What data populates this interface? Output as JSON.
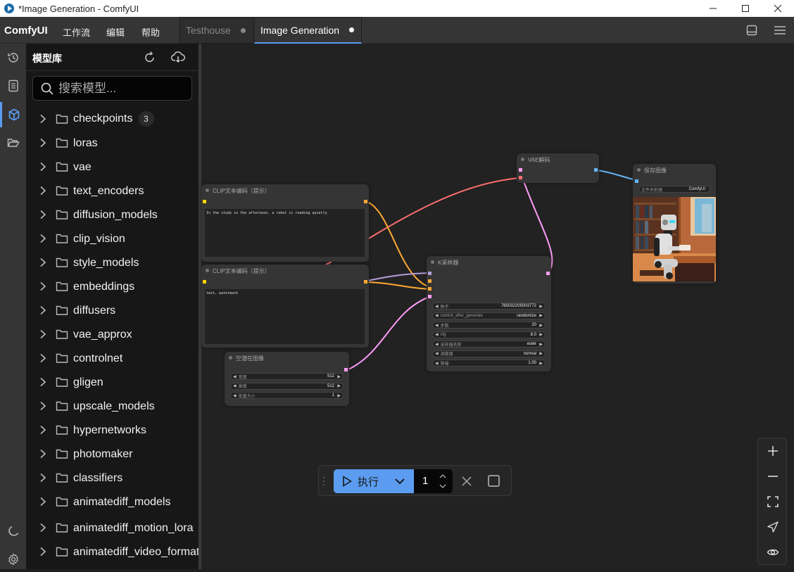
{
  "window": {
    "title": "*Image Generation - ComfyUI",
    "controls": [
      "minimize-icon",
      "maximize-icon",
      "close-icon"
    ]
  },
  "menubar": {
    "brand": "ComfyUI",
    "menus": [
      "工作流",
      "编辑",
      "帮助"
    ],
    "tabs": [
      {
        "label": "Testhouse",
        "active": false,
        "unsaved": true
      },
      {
        "label": "Image Generation",
        "active": true,
        "unsaved": true
      }
    ],
    "right_icons": [
      "bottom-panel-icon",
      "hamburger-menu-icon"
    ]
  },
  "iconbar": {
    "items": [
      {
        "name": "history-icon",
        "active": false
      },
      {
        "name": "queue-icon",
        "active": false
      },
      {
        "name": "model-library-icon",
        "active": true
      },
      {
        "name": "workflows-icon",
        "active": false
      }
    ],
    "bottom": [
      "theme-toggle-icon",
      "settings-icon"
    ]
  },
  "sidebar": {
    "title": "模型库",
    "refresh_icon": "refresh-icon",
    "download_icon": "cloud-download-icon",
    "search_placeholder": "搜索模型...",
    "folders": [
      {
        "label": "checkpoints",
        "count": "3"
      },
      {
        "label": "loras"
      },
      {
        "label": "vae"
      },
      {
        "label": "text_encoders"
      },
      {
        "label": "diffusion_models"
      },
      {
        "label": "clip_vision"
      },
      {
        "label": "style_models"
      },
      {
        "label": "embeddings"
      },
      {
        "label": "diffusers"
      },
      {
        "label": "vae_approx"
      },
      {
        "label": "controlnet"
      },
      {
        "label": "gligen"
      },
      {
        "label": "upscale_models"
      },
      {
        "label": "hypernetworks"
      },
      {
        "label": "photomaker"
      },
      {
        "label": "classifiers"
      },
      {
        "label": "animatediff_models"
      },
      {
        "label": "animatediff_motion_lora"
      },
      {
        "label": "animatediff_video_formats"
      }
    ]
  },
  "nodes": {
    "clip_positive": {
      "title": "CLIP文本编码（提示）",
      "text": "In the study in the afternoon, a robot is reading quietly"
    },
    "clip_negative": {
      "title": "CLIP文本编码（提示）",
      "text": "text, watermark"
    },
    "empty_latent": {
      "title": "空潜在图像",
      "widgets": [
        {
          "label": "宽度",
          "value": "512"
        },
        {
          "label": "高度",
          "value": "512"
        },
        {
          "label": "批量大小",
          "value": "1"
        }
      ]
    },
    "ksampler": {
      "title": "K采样器",
      "widgets": [
        {
          "label": "种子",
          "value": "765032205003772"
        },
        {
          "label": "control_after_generate",
          "value": "randomize"
        },
        {
          "label": "步数",
          "value": "20"
        },
        {
          "label": "cfg",
          "value": "8.0"
        },
        {
          "label": "采样器名称",
          "value": "euler"
        },
        {
          "label": "调度器",
          "value": "normal"
        },
        {
          "label": "降噪",
          "value": "1.00"
        }
      ]
    },
    "vae_decode": {
      "title": "VAE解码"
    },
    "save_image": {
      "title": "保存图像",
      "widgets": [
        {
          "label": "文件名前缀",
          "value": "ComfyUI"
        }
      ],
      "preview_alt": "robot reading in a study"
    }
  },
  "link_colors": {
    "conditioning": "#ffa931",
    "latent": "#ff9cf9",
    "vae": "#ff6e6e",
    "image": "#64b5f6",
    "model": "#b39ddb",
    "clip": "#ffd500"
  },
  "runbar": {
    "run_label": "执行",
    "count": "1"
  },
  "zoom_controls": [
    "zoom-in-icon",
    "zoom-out-icon",
    "fit-view-icon",
    "locate-icon",
    "toggle-links-icon"
  ],
  "accent": "#5b9cf0"
}
